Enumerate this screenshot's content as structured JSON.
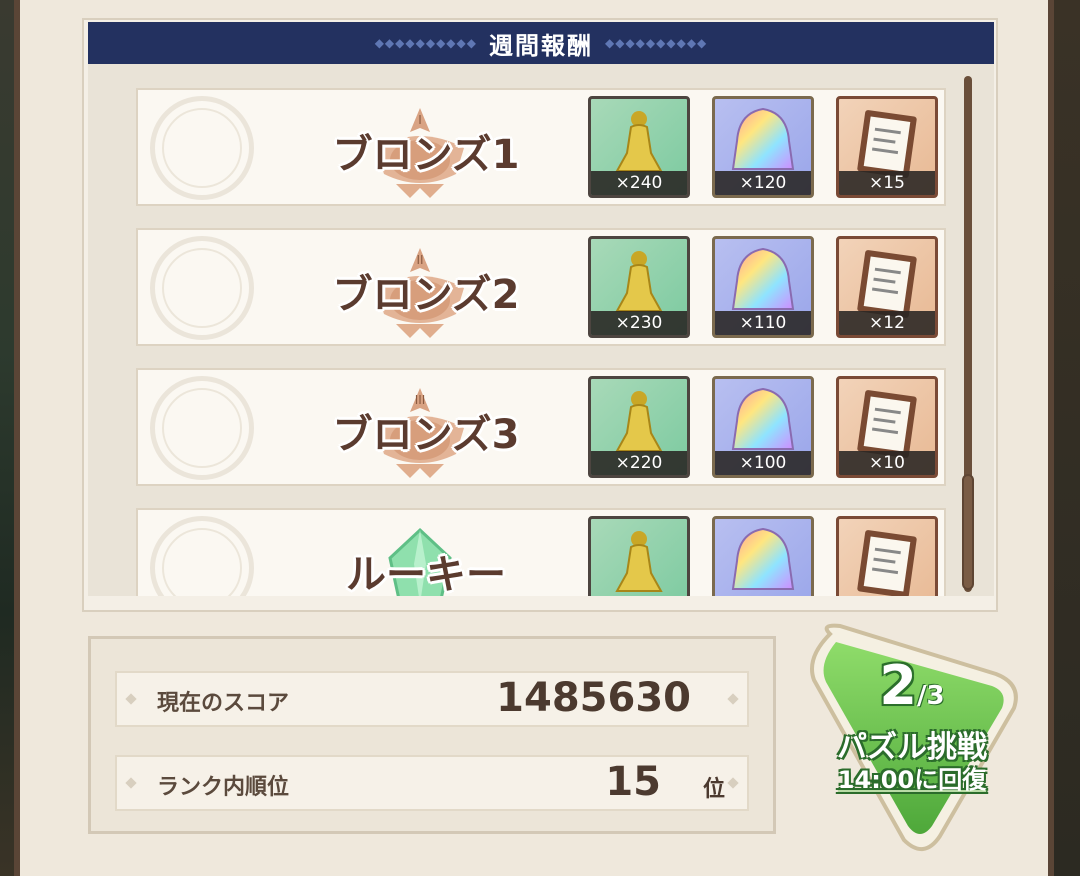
{
  "header": {
    "title": "週間報酬"
  },
  "ranks": [
    {
      "name": "ブロンズ1",
      "emblem": "bronze-emblem",
      "numeral": "I",
      "rewards": [
        {
          "icon": "gold-statue-icon",
          "qty": "×240"
        },
        {
          "icon": "rainbow-gem-icon",
          "qty": "×120"
        },
        {
          "icon": "clipboard-icon",
          "qty": "×15"
        }
      ]
    },
    {
      "name": "ブロンズ2",
      "emblem": "bronze-emblem",
      "numeral": "II",
      "rewards": [
        {
          "icon": "gold-statue-icon",
          "qty": "×230"
        },
        {
          "icon": "rainbow-gem-icon",
          "qty": "×110"
        },
        {
          "icon": "clipboard-icon",
          "qty": "×12"
        }
      ]
    },
    {
      "name": "ブロンズ3",
      "emblem": "bronze-emblem",
      "numeral": "III",
      "rewards": [
        {
          "icon": "gold-statue-icon",
          "qty": "×220"
        },
        {
          "icon": "rainbow-gem-icon",
          "qty": "×100"
        },
        {
          "icon": "clipboard-icon",
          "qty": "×10"
        }
      ]
    },
    {
      "name": "ルーキー",
      "emblem": "green-crystal-emblem",
      "rewards": [
        {
          "icon": "gold-statue-icon"
        },
        {
          "icon": "rainbow-gem-icon"
        },
        {
          "icon": "clipboard-icon"
        }
      ]
    }
  ],
  "score": {
    "label": "現在のスコア",
    "value": "1485630"
  },
  "ranking": {
    "label": "ランク内順位",
    "value": "15",
    "unit": "位"
  },
  "challenge": {
    "current": "2",
    "max": "/3",
    "label": "パズル挑戦",
    "recovery": "14:00に回復"
  },
  "colors": {
    "header": "#233160",
    "bronze": "#d9a383",
    "rookie": "#8fe0ad",
    "challenge": "#6cc24a"
  }
}
